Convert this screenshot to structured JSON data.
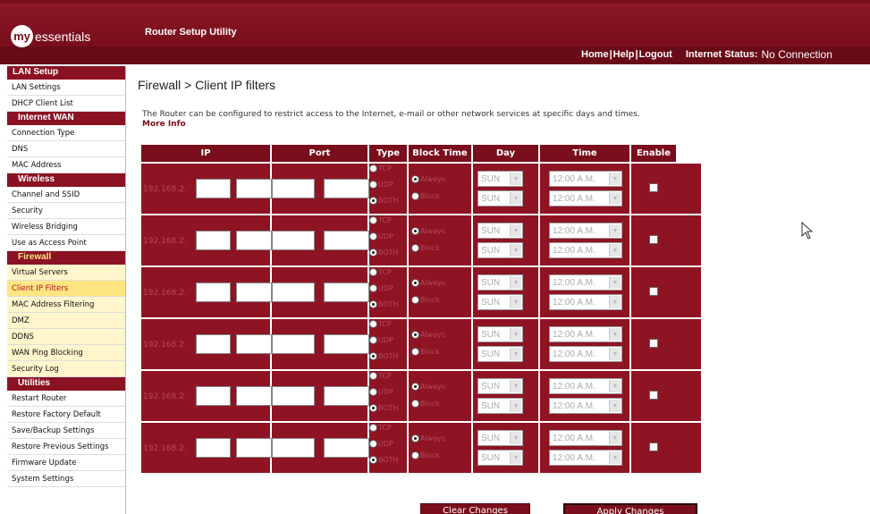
{
  "header": {
    "logo_prefix": "my",
    "logo_word": "essentials",
    "app_title": "Router Setup Utility",
    "links": [
      "Home",
      "Help",
      "Logout"
    ],
    "status_label": "Internet Status:",
    "status_value": "No Connection"
  },
  "sidebar": {
    "sections": [
      {
        "title": "LAN Setup",
        "items": [
          "LAN Settings",
          "DHCP Client List"
        ]
      },
      {
        "title": "Internet WAN",
        "items": [
          "Connection Type",
          "DNS",
          "MAC Address"
        ]
      },
      {
        "title": "Wireless",
        "items": [
          "Channel and SSID",
          "Security",
          "Wireless Bridging",
          "Use as Access Point"
        ]
      },
      {
        "title": "Firewall",
        "items": [
          "Virtual Servers",
          "Client IP Filters",
          "MAC Address Filtering",
          "DMZ",
          "DDNS",
          "WAN Ping Blocking",
          "Security Log"
        ]
      },
      {
        "title": "Utilities",
        "items": [
          "Restart Router",
          "Restore Factory Default",
          "Save/Backup Settings",
          "Restore Previous Settings",
          "Firmware Update",
          "System Settings"
        ]
      }
    ],
    "active_item": "Client IP Filters"
  },
  "main": {
    "title": "Firewall > Client IP filters",
    "description": "The Router can be configured to restrict access to the Internet, e-mail or other network services at specific days and times.",
    "more_info": "More Info",
    "columns": [
      "IP",
      "Port",
      "Type",
      "Block Time",
      "Day",
      "Time",
      "Enable"
    ],
    "ip_prefix": "192.168.2.",
    "type_options": [
      "TCP",
      "UDP",
      "BOTH"
    ],
    "block_options": [
      "Always",
      "Block"
    ],
    "day_value": "SUN",
    "time_value": "12:00 A.M.",
    "row_count": 6,
    "buttons": {
      "clear": "Clear Changes",
      "apply": "Apply Changes"
    }
  },
  "colors": {
    "brand": "#7a0e1c",
    "active_bg": "#ffe680",
    "firewall_bg": "#fff6cc"
  }
}
